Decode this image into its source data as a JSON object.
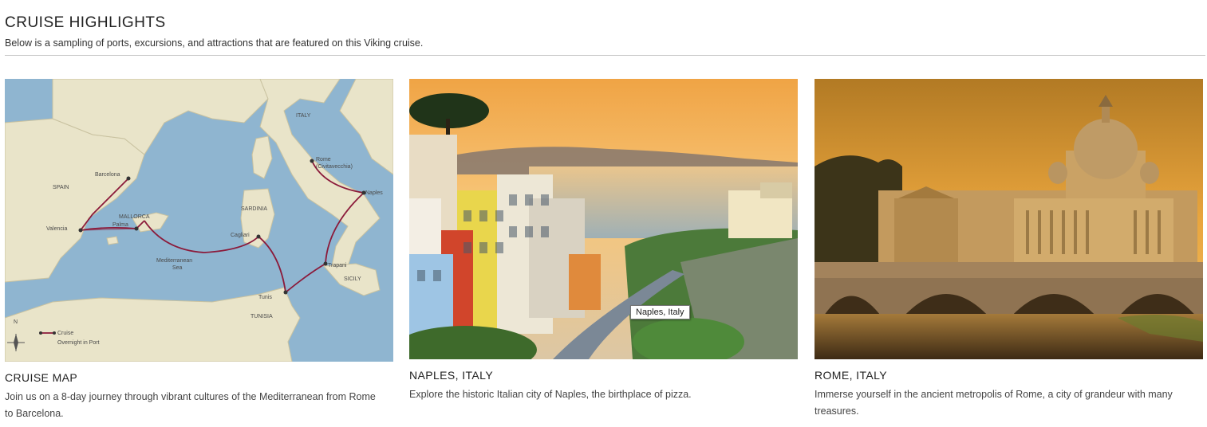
{
  "header": {
    "title": "CRUISE HIGHLIGHTS",
    "subtitle": "Below is a sampling of ports, excursions, and attractions that are featured on this Viking cruise."
  },
  "cards": [
    {
      "title": "CRUISE MAP",
      "description": "Join us on a 8-day journey through vibrant cultures of the Mediterranean from Rome to Barcelona.",
      "map": {
        "countries": [
          "ITALY",
          "SPAIN",
          "SARDINIA",
          "SICILY",
          "TUNISIA"
        ],
        "ports": [
          "Barcelona",
          "Valencia",
          "Palma",
          "Cagliari",
          "Tunis",
          "Trapani",
          "Naples",
          "Rome",
          "(Civitavecchia)"
        ],
        "region_labels": [
          "MALLORCA"
        ],
        "sea_label": [
          "Mediterranean",
          "Sea"
        ],
        "compass": "N",
        "legend": {
          "cruise": "Cruise",
          "overnight": "Overnight in Port"
        },
        "colors": {
          "sea": "#8fb5d0",
          "land": "#e9e4c9",
          "route": "#8b1a3a"
        }
      }
    },
    {
      "title": "NAPLES, ITALY",
      "description": "Explore the historic Italian city of Naples, the birthplace of pizza.",
      "tooltip": "Naples, Italy"
    },
    {
      "title": "ROME, ITALY",
      "description": "Immerse yourself in the ancient metropolis of Rome, a city of grandeur with many treasures."
    }
  ]
}
